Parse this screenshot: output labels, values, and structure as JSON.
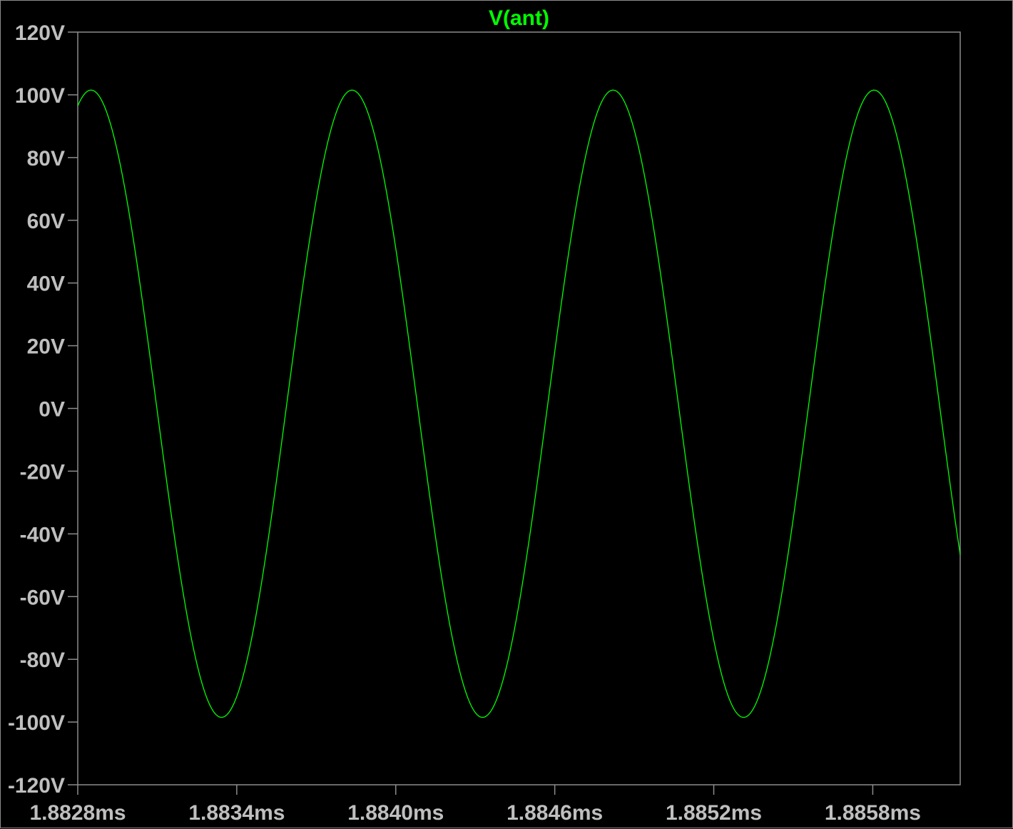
{
  "chart_data": {
    "type": "line",
    "title": "",
    "xlabel": "",
    "ylabel": "",
    "x_unit": "ms",
    "y_unit": "V",
    "xlim": [
      1.8828,
      1.88613
    ],
    "ylim": [
      -120,
      120
    ],
    "x_ticks": [
      1.8828,
      1.8834,
      1.884,
      1.8846,
      1.8852,
      1.8858
    ],
    "x_tick_labels": [
      "1.8828ms",
      "1.8834ms",
      "1.8840ms",
      "1.8846ms",
      "1.8852ms",
      "1.8858ms"
    ],
    "y_ticks": [
      120,
      100,
      80,
      60,
      40,
      20,
      0,
      -20,
      -40,
      -60,
      -80,
      -100,
      -120
    ],
    "y_tick_labels": [
      "120V",
      "100V",
      "80V",
      "60V",
      "40V",
      "20V",
      "0V",
      "-20V",
      "-40V",
      "-60V",
      "-80V",
      "-100V",
      "-120V"
    ],
    "grid": false,
    "series": [
      {
        "name": "V(ant)",
        "color": "#00ff00",
        "amplitude": 100,
        "offset": 1.5,
        "period_ms": 0.000985,
        "peak_time_ms": 1.88285,
        "x_start": 1.8828,
        "x_end": 1.88613
      }
    ]
  },
  "colors": {
    "background": "#000000",
    "axis": "#8c8c8c",
    "tick_text": "#bfbfbf",
    "trace": "#00ff00"
  }
}
